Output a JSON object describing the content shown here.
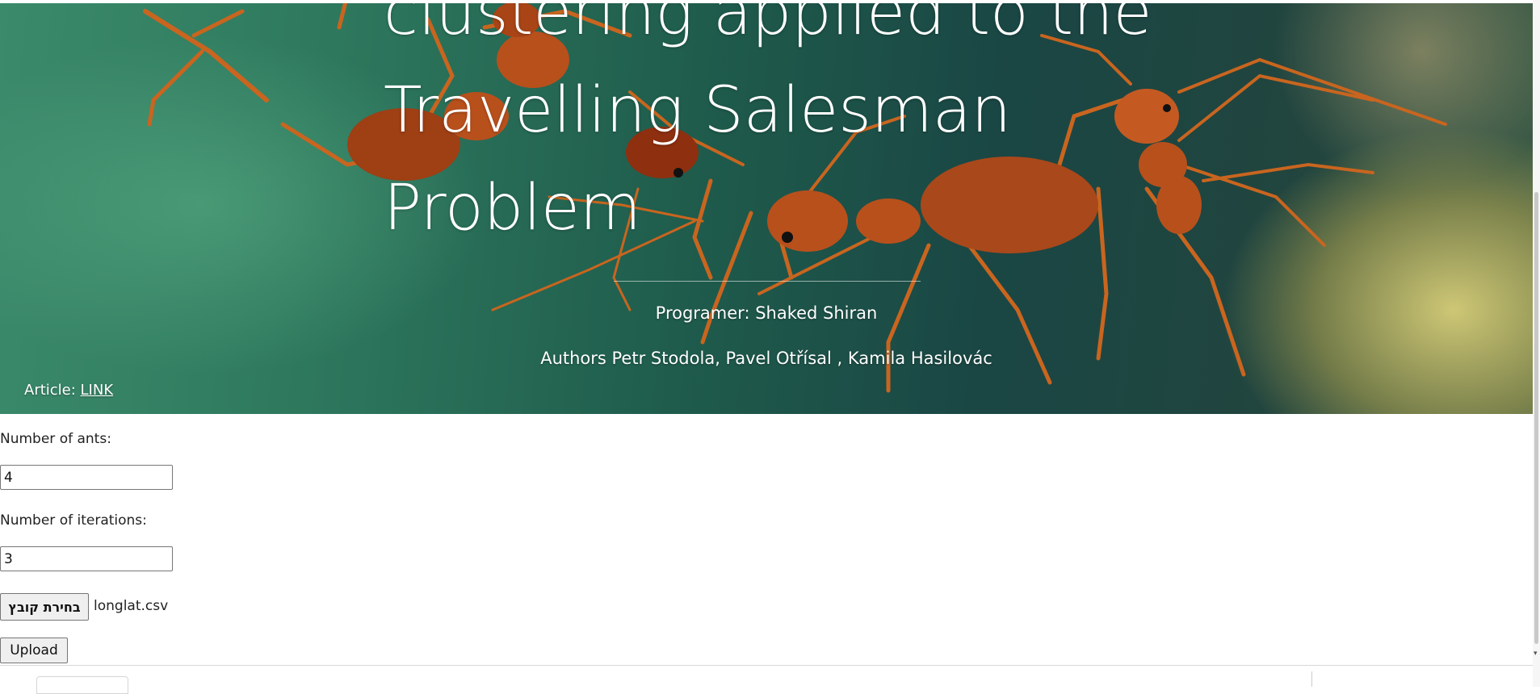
{
  "hero": {
    "title": "clustering applied to the Travelling Salesman Problem",
    "programmer": "Programer: Shaked Shiran",
    "authors": "Authors Petr Stodola, Pavel Otřísal , Kamila Hasilovác",
    "article_label": "Article: ",
    "article_link": "LINK",
    "background_image": "red ants on leaf"
  },
  "form": {
    "ants_label": "Number of ants:",
    "ants_value": "4",
    "iterations_label": "Number of iterations:",
    "iterations_value": "3",
    "file_button": "בחירת קובץ",
    "file_name": "longlat.csv",
    "upload_button": "Upload"
  },
  "colors": {
    "hero_green": "#2f7a5f",
    "ant_orange": "#c8551c",
    "text_white": "#ffffff"
  }
}
